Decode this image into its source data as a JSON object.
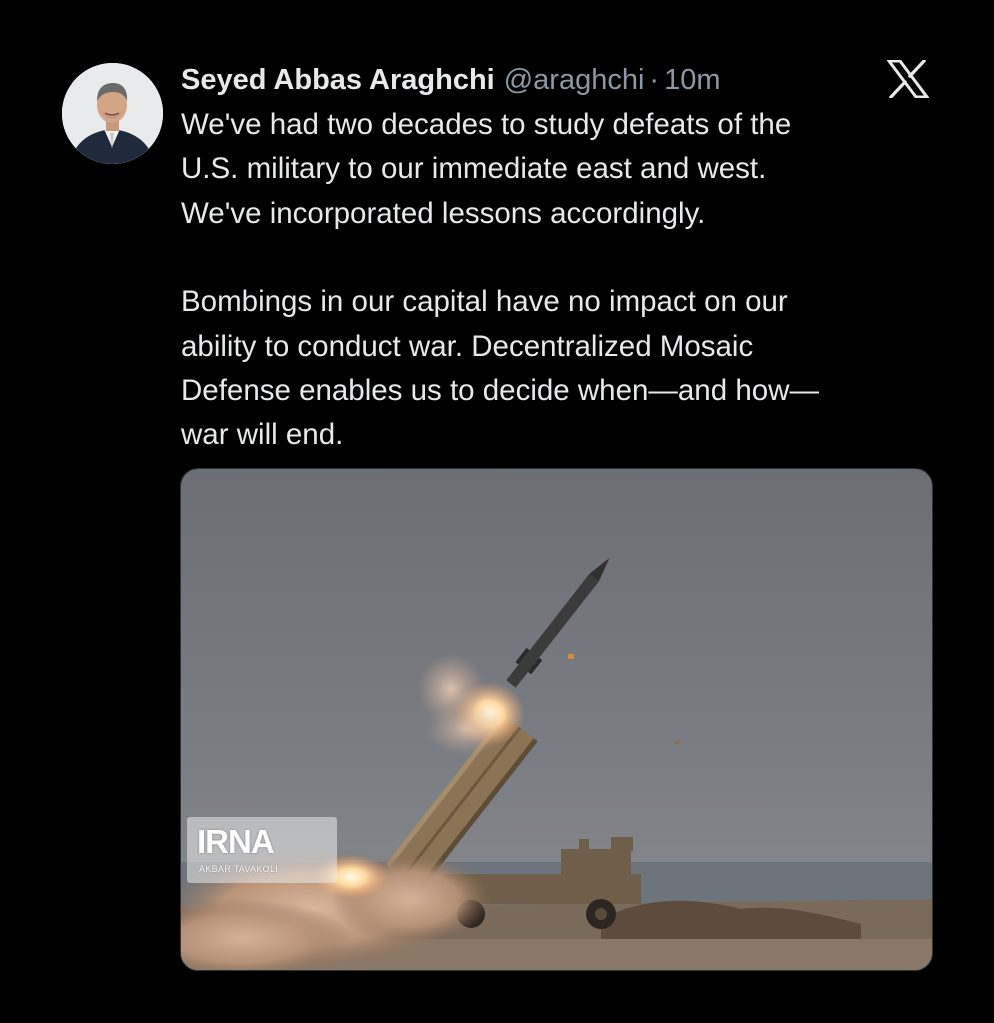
{
  "tweet": {
    "author_name": "Seyed Abbas Araghchi",
    "handle": "@araghchi",
    "separator": "·",
    "timestamp": "10m",
    "paragraphs": [
      "We've had two decades to study defeats of the\nU.S. military to our immediate east and west.\nWe've incorporated lessons accordingly.",
      "Bombings in our capital have no impact on our\nability to conduct war. Decentralized Mosaic\nDefense enables us to decide when—and how—\nwar will end."
    ],
    "media": {
      "watermark_logo": "IRNA",
      "watermark_credit": "AKBAR TAVAKOLI"
    }
  },
  "icons": {
    "platform": "x-logo-icon"
  },
  "colors": {
    "background": "#000000",
    "text_primary": "#e7e9ea",
    "text_secondary": "#8b98a5"
  }
}
